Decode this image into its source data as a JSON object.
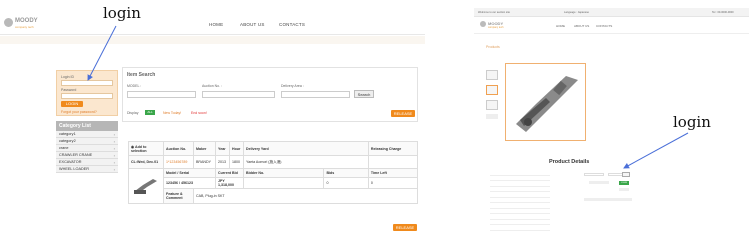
{
  "annotations": {
    "left_label": "login",
    "right_label": "login"
  },
  "left": {
    "logo": {
      "name": "MOODY",
      "tagline": "company tech"
    },
    "nav": [
      "HOME",
      "ABOUT US",
      "CONTACTS"
    ],
    "login": {
      "id_label": "Login ID",
      "password_label": "Password",
      "button": "LOGIN",
      "forgot": "Forgot your password?"
    },
    "category": {
      "title": "Category List",
      "items": [
        "category1",
        "category2",
        "crane",
        "CRAWLER CRANE",
        "EXCAVATOR",
        "WHEEL LOADER"
      ]
    },
    "search": {
      "title": "Item Search",
      "model_label": "MODEL :",
      "auction_label": "Auction No. :",
      "delivery_label": "Delivery Area :",
      "search_button": "Search",
      "filters": {
        "label": "Display",
        "all": "ALL",
        "new_today": "New Today!",
        "end_soon": "End soon!"
      },
      "release_button": "RELEASE"
    },
    "table": {
      "row1": {
        "add": "Add to selection",
        "auction_no": "Auction No.",
        "maker": "Maker",
        "year": "Year",
        "hour": "Hour",
        "delivery": "Delivery Yard",
        "releasing": "Releasing Charge"
      },
      "row2": {
        "date": "CL:Wed, Dec.01",
        "auction_no": "1*123456789",
        "maker": "BRANDY",
        "year": "2013",
        "hour": "1800",
        "delivery": "Yaeta Aomori (施入港)"
      },
      "row3": {
        "model": "Model / Serial",
        "current_bid": "Current Bid",
        "bidder_no": "Bidder No.",
        "bids": "Bids",
        "time_left": "Time Left"
      },
      "row4": {
        "model_value": "123456 / 456123",
        "current_bid_value": "JPY 1,318,000",
        "bids_value": "0",
        "time_left_value": "0"
      },
      "row5": {
        "feature": "Feature & Comment",
        "feature_value": "CAB, Plug-in SKT"
      }
    },
    "bottom_release": "RELEASE"
  },
  "right": {
    "topbar": {
      "left": "Welcome to our auction site",
      "lang": "Language : Japanese",
      "tel": "Tel : 00-0000-0000"
    },
    "logo": {
      "name": "MOODY",
      "tagline": "company tech"
    },
    "nav": [
      "HOME",
      "ABOUT US",
      "CONTACTS"
    ],
    "breadcrumb": "Products",
    "product_details_title": "Product Details",
    "login_button": "LOGIN",
    "release": "RELEASE"
  }
}
